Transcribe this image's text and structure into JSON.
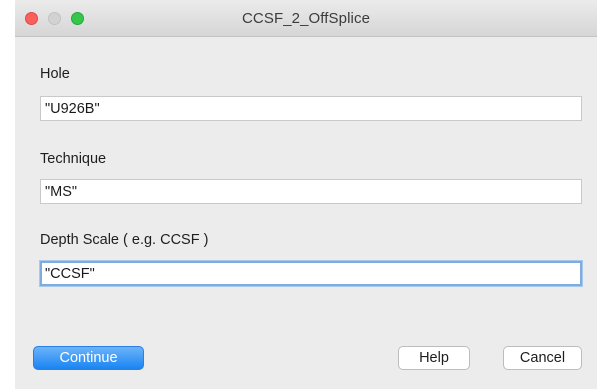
{
  "window": {
    "title": "CCSF_2_OffSplice"
  },
  "form": {
    "hole": {
      "label": "Hole",
      "value": "\"U926B\""
    },
    "technique": {
      "label": "Technique",
      "value": "\"MS\""
    },
    "depth_scale": {
      "label": "Depth Scale ( e.g. CCSF )",
      "value": "\"CCSF\""
    }
  },
  "buttons": {
    "continue": "Continue",
    "help": "Help",
    "cancel": "Cancel"
  },
  "colors": {
    "primary_button": "#1a84f2",
    "focus_ring": "#7eacde",
    "close_light": "#fc605c",
    "zoom_light": "#34c749"
  }
}
